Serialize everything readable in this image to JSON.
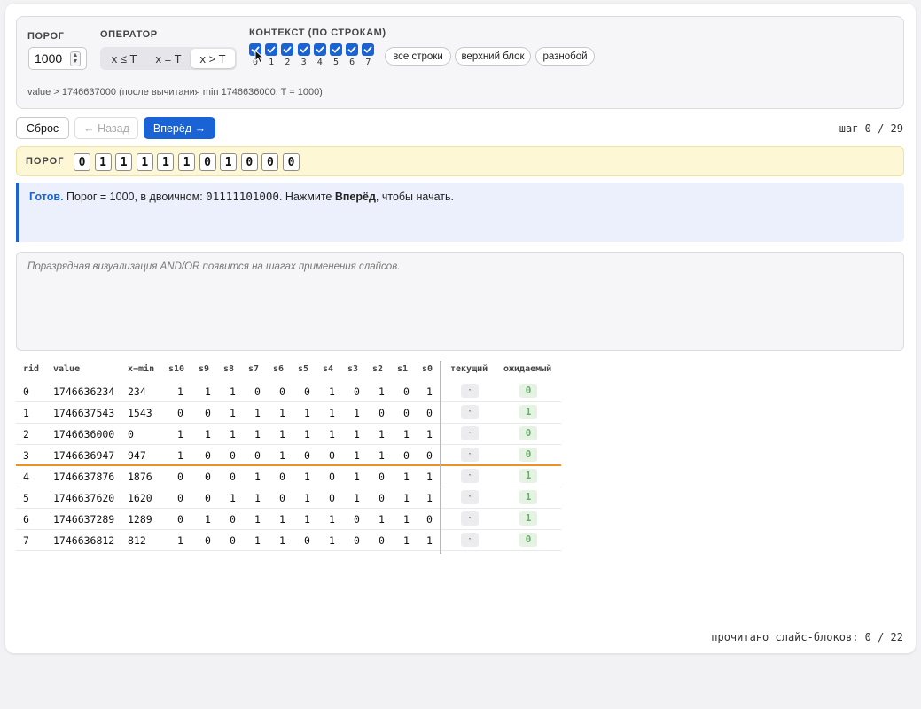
{
  "controls": {
    "threshold_label": "ПОРОГ",
    "threshold_value": "1000",
    "operator_label": "ОПЕРАТОР",
    "operators": [
      "x ≤ T",
      "x = T",
      "x > T"
    ],
    "operator_selected": "x > T",
    "context_label": "КОНТЕКСТ (ПО СТРОКАМ)",
    "context_rows": [
      "0",
      "1",
      "2",
      "3",
      "4",
      "5",
      "6",
      "7"
    ],
    "context_checked": [
      true,
      true,
      true,
      true,
      true,
      true,
      true,
      true
    ],
    "presets": [
      "все строки",
      "верхний блок",
      "разнобой"
    ],
    "expression": "value > 1746637000 (после вычитания min 1746636000: T = 1000)"
  },
  "nav": {
    "reset": "Сброс",
    "back": "← Назад",
    "forward": "Вперёд →",
    "step": "шаг 0 / 29"
  },
  "threshold_bits": {
    "label": "ПОРОГ",
    "bits": [
      "0",
      "1",
      "1",
      "1",
      "1",
      "1",
      "0",
      "1",
      "0",
      "0",
      "0"
    ]
  },
  "status": {
    "ready": "Готов.",
    "text1": " Порог = 1000, в двоичном: ",
    "binary": "01111101000",
    "text2": ". Нажмите ",
    "forward_word": "Вперёд",
    "text3": ", чтобы начать."
  },
  "viz": {
    "placeholder": "Поразрядная визуализация AND/OR появится на шагах применения слайсов."
  },
  "table": {
    "headers": [
      "rid",
      "value",
      "x−min",
      "s10",
      "s9",
      "s8",
      "s7",
      "s6",
      "s5",
      "s4",
      "s3",
      "s2",
      "s1",
      "s0",
      "текущий",
      "ожидаемый"
    ],
    "rows": [
      {
        "rid": "0",
        "value": "1746636234",
        "xmin": "234",
        "bits": [
          "1",
          "1",
          "1",
          "0",
          "0",
          "0",
          "1",
          "0",
          "1",
          "0",
          "1"
        ],
        "current": "·",
        "expected": "0"
      },
      {
        "rid": "1",
        "value": "1746637543",
        "xmin": "1543",
        "bits": [
          "0",
          "0",
          "1",
          "1",
          "1",
          "1",
          "1",
          "1",
          "0",
          "0",
          "0"
        ],
        "current": "·",
        "expected": "1"
      },
      {
        "rid": "2",
        "value": "1746636000",
        "xmin": "0",
        "bits": [
          "1",
          "1",
          "1",
          "1",
          "1",
          "1",
          "1",
          "1",
          "1",
          "1",
          "1"
        ],
        "current": "·",
        "expected": "0"
      },
      {
        "rid": "3",
        "value": "1746636947",
        "xmin": "947",
        "bits": [
          "1",
          "0",
          "0",
          "0",
          "1",
          "0",
          "0",
          "1",
          "1",
          "0",
          "0"
        ],
        "current": "·",
        "expected": "0"
      },
      {
        "rid": "4",
        "value": "1746637876",
        "xmin": "1876",
        "bits": [
          "0",
          "0",
          "0",
          "1",
          "0",
          "1",
          "0",
          "1",
          "0",
          "1",
          "1"
        ],
        "current": "·",
        "expected": "1"
      },
      {
        "rid": "5",
        "value": "1746637620",
        "xmin": "1620",
        "bits": [
          "0",
          "0",
          "1",
          "1",
          "0",
          "1",
          "0",
          "1",
          "0",
          "1",
          "1"
        ],
        "current": "·",
        "expected": "1"
      },
      {
        "rid": "6",
        "value": "1746637289",
        "xmin": "1289",
        "bits": [
          "0",
          "1",
          "0",
          "1",
          "1",
          "1",
          "1",
          "0",
          "1",
          "1",
          "0"
        ],
        "current": "·",
        "expected": "1"
      },
      {
        "rid": "7",
        "value": "1746636812",
        "xmin": "812",
        "bits": [
          "1",
          "0",
          "0",
          "1",
          "1",
          "0",
          "1",
          "0",
          "0",
          "1",
          "1"
        ],
        "current": "·",
        "expected": "0"
      }
    ]
  },
  "footer": "прочитано слайс-блоков: 0 / 22"
}
